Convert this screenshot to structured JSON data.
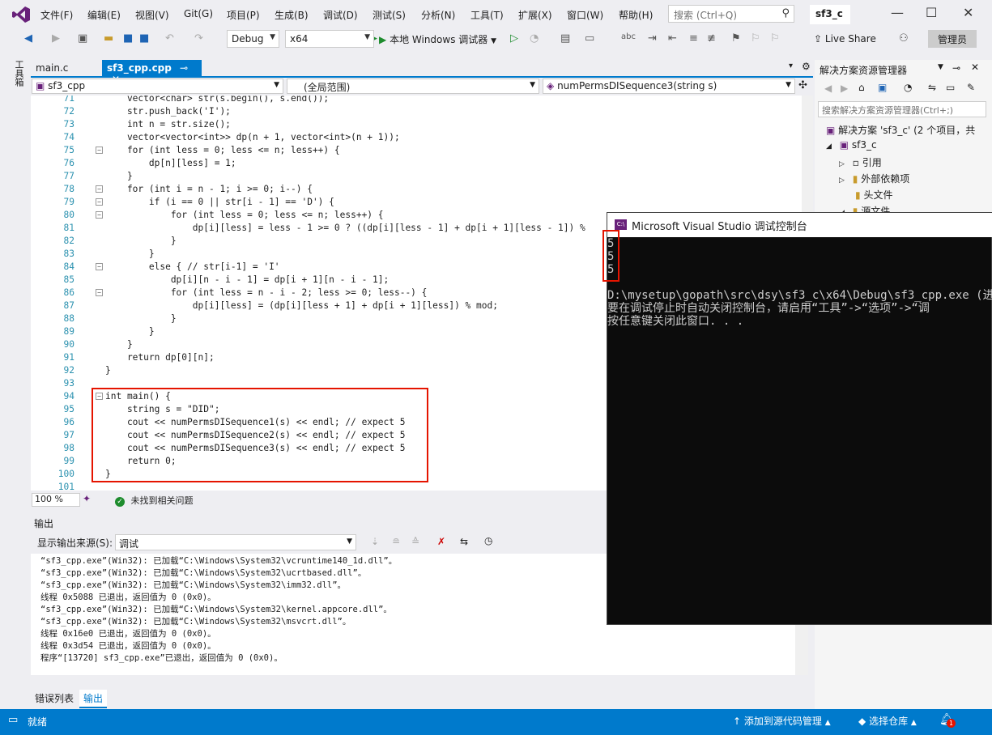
{
  "menubar": {
    "items": [
      "文件(F)",
      "编辑(E)",
      "视图(V)",
      "Git(G)",
      "项目(P)",
      "生成(B)",
      "调试(D)",
      "测试(S)",
      "分析(N)",
      "工具(T)",
      "扩展(X)",
      "窗口(W)",
      "帮助(H)"
    ],
    "search_placeholder": "搜索 (Ctrl+Q)",
    "solution_tab": "sf3_c"
  },
  "toolbar": {
    "config": "Debug",
    "platform": "x64",
    "run_label": "本地 Windows 调试器",
    "live_share": "Live Share",
    "admin": "管理员"
  },
  "left_strip": {
    "label": "工具箱"
  },
  "editor": {
    "tabs": [
      {
        "label": "main.c",
        "active": false
      },
      {
        "label": "sf3_cpp.cpp",
        "active": true
      }
    ],
    "nav_project": "sf3_cpp",
    "nav_scope": "(全局范围)",
    "nav_member": "numPermsDISequence3(string s)",
    "lines": [
      {
        "n": "71",
        "text": "    vector<char> str(s.begin(), s.end());"
      },
      {
        "n": "72",
        "text": "    str.push_back('I');"
      },
      {
        "n": "73",
        "text": "    int n = str.size();"
      },
      {
        "n": "74",
        "text": "    vector<vector<int>> dp(n + 1, vector<int>(n + 1));"
      },
      {
        "n": "75",
        "text": "    for (int less = 0; less <= n; less++) {"
      },
      {
        "n": "76",
        "text": "        dp[n][less] = 1;"
      },
      {
        "n": "77",
        "text": "    }"
      },
      {
        "n": "78",
        "text": "    for (int i = n - 1; i >= 0; i--) {"
      },
      {
        "n": "79",
        "text": "        if (i == 0 || str[i - 1] == 'D') {"
      },
      {
        "n": "80",
        "text": "            for (int less = 0; less <= n; less++) {"
      },
      {
        "n": "81",
        "text": "                dp[i][less] = less - 1 >= 0 ? ((dp[i][less - 1] + dp[i + 1][less - 1]) %"
      },
      {
        "n": "82",
        "text": "            }"
      },
      {
        "n": "83",
        "text": "        }"
      },
      {
        "n": "84",
        "text": "        else { // str[i-1] = 'I'"
      },
      {
        "n": "85",
        "text": "            dp[i][n - i - 1] = dp[i + 1][n - i - 1];"
      },
      {
        "n": "86",
        "text": "            for (int less = n - i - 2; less >= 0; less--) {"
      },
      {
        "n": "87",
        "text": "                dp[i][less] = (dp[i][less + 1] + dp[i + 1][less]) % mod;"
      },
      {
        "n": "88",
        "text": "            }"
      },
      {
        "n": "89",
        "text": "        }"
      },
      {
        "n": "90",
        "text": "    }"
      },
      {
        "n": "91",
        "text": "    return dp[0][n];"
      },
      {
        "n": "92",
        "text": "}"
      },
      {
        "n": "93",
        "text": ""
      },
      {
        "n": "94",
        "text": "int main() {"
      },
      {
        "n": "95",
        "text": "    string s = \"DID\";"
      },
      {
        "n": "96",
        "text": "    cout << numPermsDISequence1(s) << endl; // expect 5"
      },
      {
        "n": "97",
        "text": "    cout << numPermsDISequence2(s) << endl; // expect 5"
      },
      {
        "n": "98",
        "text": "    cout << numPermsDISequence3(s) << endl; // expect 5"
      },
      {
        "n": "99",
        "text": "    return 0;"
      },
      {
        "n": "100",
        "text": "}"
      },
      {
        "n": "101",
        "text": ""
      }
    ],
    "zoom": "100 %",
    "issues": "未找到相关问题"
  },
  "output": {
    "title": "输出",
    "source_label": "显示输出来源(S):",
    "source_value": "调试",
    "lines": [
      "“sf3_cpp.exe”(Win32): 已加载“C:\\Windows\\System32\\vcruntime140_1d.dll”。",
      "“sf3_cpp.exe”(Win32): 已加载“C:\\Windows\\System32\\ucrtbased.dll”。",
      "“sf3_cpp.exe”(Win32): 已加载“C:\\Windows\\System32\\imm32.dll”。",
      "线程 0x5088 已退出，返回值为 0 (0x0)。",
      "“sf3_cpp.exe”(Win32): 已加载“C:\\Windows\\System32\\kernel.appcore.dll”。",
      "“sf3_cpp.exe”(Win32): 已加载“C:\\Windows\\System32\\msvcrt.dll”。",
      "线程 0x16e0 已退出，返回值为 0 (0x0)。",
      "线程 0x3d54 已退出，返回值为 0 (0x0)。",
      "程序“[13720] sf3_cpp.exe”已退出，返回值为 0 (0x0)。"
    ],
    "tabs": [
      "错误列表",
      "输出"
    ]
  },
  "solution_explorer": {
    "title": "解决方案资源管理器",
    "search_placeholder": "搜索解决方案资源管理器(Ctrl+;)",
    "items": [
      {
        "label": "解决方案 'sf3_c' (2 个项目，共"
      },
      {
        "label": "sf3_c"
      },
      {
        "label": "引用"
      },
      {
        "label": "外部依赖项"
      },
      {
        "label": "头文件"
      },
      {
        "label": "源文件"
      }
    ]
  },
  "console": {
    "title": "Microsoft Visual Studio 调试控制台",
    "lines": [
      "5",
      "5",
      "5",
      "",
      "D:\\mysetup\\gopath\\src\\dsy\\sf3_c\\x64\\Debug\\sf3_cpp.exe (进程",
      "要在调试停止时自动关闭控制台，请启用“工具”->“选项”->“调",
      "按任意键关闭此窗口. . ."
    ]
  },
  "statusbar": {
    "ready": "就绪",
    "add_source": "添加到源代码管理",
    "select_repo": "选择仓库",
    "notifications": "1"
  },
  "colors": {
    "accent": "#007acc",
    "highlight_border": "#e51400",
    "console_bg": "#0c0c0c"
  }
}
